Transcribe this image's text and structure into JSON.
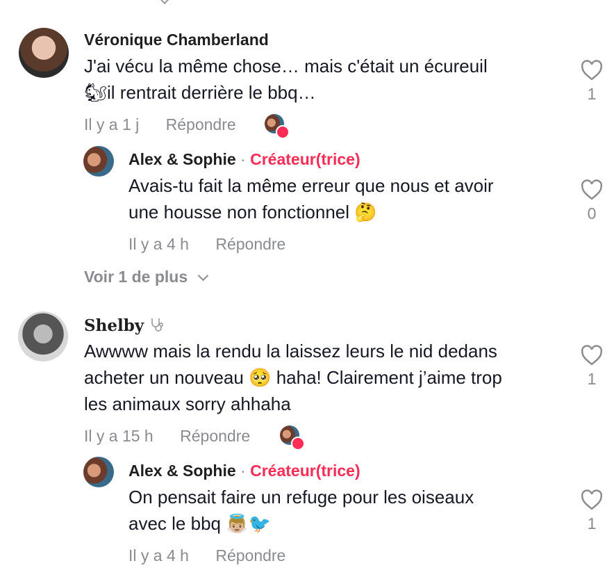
{
  "comments": [
    {
      "author": "Véronique Chamberland",
      "text_line1": "J'ai vécu la même chose… mais c'était un écureuil",
      "text_line2_emoji": "🐿",
      "text_line2": "il rentrait derrière le bbq…",
      "time": "Il y a 1 j",
      "reply_label": "Répondre",
      "likes": "1",
      "reply": {
        "author": "Alex & Sophie",
        "separator": "·",
        "badge": "Créateur(trice)",
        "text_line1": "Avais-tu fait la même erreur que nous et avoir",
        "text_line2": "une housse non fonctionnel",
        "emoji": "🤔",
        "time": "Il y a 4 h",
        "reply_label": "Répondre",
        "likes": "0"
      },
      "more_label": "Voir 1 de plus"
    },
    {
      "author": "Shelby",
      "author_icon": "stethoscope-icon",
      "text_line1": "Awwww mais la rendu la laissez leurs le nid dedans",
      "text_line2": "acheter un nouveau",
      "emoji": "🥺",
      "text_line2_rest": "haha! Clairement j’aime trop",
      "text_line3": "les animaux sorry ahhaha",
      "time": "Il y a 15 h",
      "reply_label": "Répondre",
      "likes": "1",
      "reply": {
        "author": "Alex & Sophie",
        "separator": "·",
        "badge": "Créateur(trice)",
        "text_line1": "On pensait faire un refuge pour les oiseaux",
        "text_line2": "avec le bbq",
        "emoji": "👼🏼🐦",
        "time": "Il y a 4 h",
        "reply_label": "Répondre",
        "likes": "1"
      }
    }
  ],
  "colors": {
    "creator": "#fe2c55",
    "meta": "#8a8b91",
    "text": "#161823"
  }
}
